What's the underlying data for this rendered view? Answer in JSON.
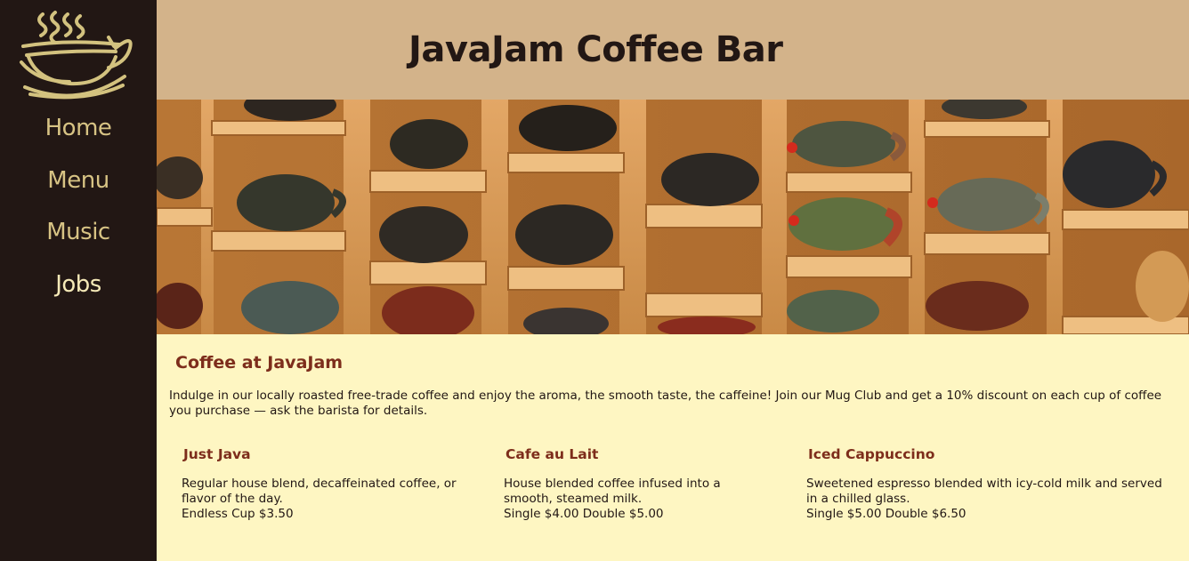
{
  "site": {
    "title": "JavaJam Coffee Bar"
  },
  "nav": {
    "items": [
      {
        "label": "Home"
      },
      {
        "label": "Menu"
      },
      {
        "label": "Music"
      },
      {
        "label": "Jobs"
      }
    ]
  },
  "main": {
    "heading": "Coffee at JavaJam",
    "intro": "Indulge in our locally roasted free-trade coffee and enjoy the aroma, the smooth taste, the caffeine! Join our Mug Club and get a 10% discount on each cup of coffee you purchase — ask the barista for details.",
    "drinks": [
      {
        "name": "Just Java",
        "description": "Regular house blend, decaffeinated coffee, or flavor of the day.",
        "price": "Endless Cup $3.50"
      },
      {
        "name": "Cafe au Lait",
        "description": "House blended coffee infused into a smooth, steamed milk.",
        "price": "Single $4.00 Double $5.00"
      },
      {
        "name": "Iced Cappuccino",
        "description": "Sweetened espresso blended with icy-cold milk and served in a chilled glass.",
        "price": "Single $5.00 Double $6.50"
      }
    ]
  },
  "colors": {
    "sidebar": "#221714",
    "header": "#d3b38a",
    "content_bg": "#fef6c2",
    "heading": "#7d2d1b",
    "nav_link": "#d7c384"
  },
  "icons": {
    "logo": "steaming-coffee-cup-icon"
  }
}
